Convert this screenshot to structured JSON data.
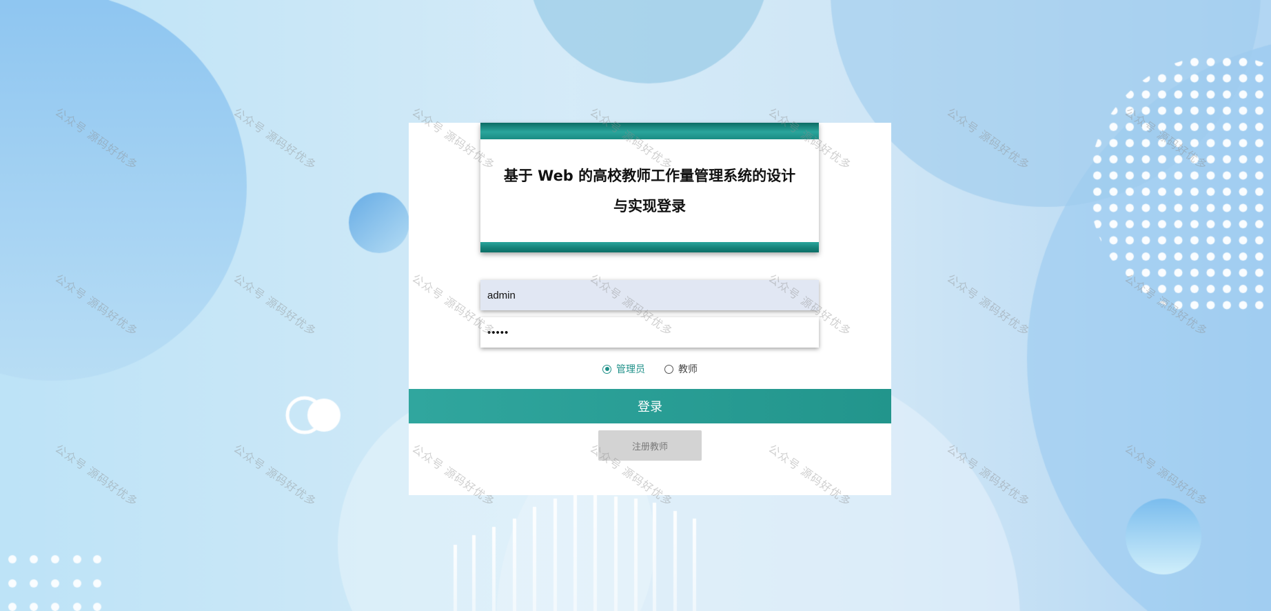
{
  "login": {
    "title_line1": "基于 Web 的高校教师工作量管理系统的设计",
    "title_line2": "与实现登录",
    "username_value": "admin",
    "password_value": "•••••",
    "roles": [
      {
        "label": "管理员",
        "selected": true
      },
      {
        "label": "教师",
        "selected": false
      }
    ],
    "login_button": "登录",
    "register_button": "注册教师"
  },
  "watermark": {
    "text": "公众号 源码好优多"
  },
  "colors": {
    "accent": "#2a9d94",
    "title_stripe": "#148077",
    "register_bg": "#d3d3d3",
    "username_bg": "#e1e7f3",
    "background": "#c9e6f7"
  }
}
